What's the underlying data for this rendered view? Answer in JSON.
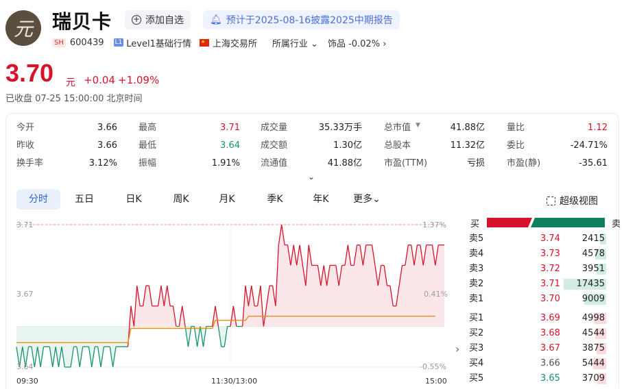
{
  "stock": {
    "name": "瑞贝卡",
    "logo_char": "元",
    "market": "SH",
    "code": "600439",
    "level": "L1",
    "level_text": "Level1基础行情",
    "exchange": "上海交易所",
    "industry_label": "所属行业",
    "sector": "饰品 -0.02%",
    "watch_label": "添加自选",
    "notice": "预计于2025-08-16披露2025中期报告"
  },
  "quote": {
    "price": "3.70",
    "unit": "元",
    "change": "+0.04",
    "change_pct": "+1.09%",
    "status": "已收盘  07-25 15:00:00 北京时间"
  },
  "stats": [
    [
      {
        "label": "今开",
        "value": "3.66"
      },
      {
        "label": "最高",
        "value": "3.71",
        "color": "red"
      },
      {
        "label": "成交量",
        "value": "35.33万手"
      },
      {
        "label": "总市值",
        "value": "41.88亿",
        "dropdown": true
      },
      {
        "label": "量比",
        "value": "1.12",
        "color": "red"
      }
    ],
    [
      {
        "label": "昨收",
        "value": "3.66"
      },
      {
        "label": "最低",
        "value": "3.64",
        "color": "green"
      },
      {
        "label": "成交额",
        "value": "1.30亿"
      },
      {
        "label": "总股本",
        "value": "11.32亿"
      },
      {
        "label": "委比",
        "value": "-24.71%"
      }
    ],
    [
      {
        "label": "换手率",
        "value": "3.12%"
      },
      {
        "label": "振幅",
        "value": "1.91%"
      },
      {
        "label": "流通值",
        "value": "41.88亿"
      },
      {
        "label": "市盈(TTM)",
        "value": "亏损"
      },
      {
        "label": "市盈(静)",
        "value": "-35.61"
      }
    ]
  ],
  "tabs": [
    "分时",
    "五日",
    "日K",
    "周K",
    "月K",
    "季K",
    "年K",
    "更多"
  ],
  "super_view": "超级视图",
  "chart_axis": {
    "y_left": [
      "3.71",
      "3.67",
      "3.64"
    ],
    "y_right": [
      "1.37%",
      "0.41%",
      "-0.55%"
    ],
    "x": [
      "09:30",
      "11:30/13:00",
      "15:00"
    ]
  },
  "chart_data": {
    "type": "line",
    "ylim": [
      3.64,
      3.71
    ],
    "prev_close": 3.66,
    "series": [
      {
        "values": [
          3.65,
          3.64,
          3.65,
          3.64,
          3.65,
          3.65,
          3.64,
          3.65,
          3.64,
          3.65,
          3.65,
          3.65,
          3.64,
          3.65,
          3.64,
          3.65,
          3.64,
          3.64,
          3.64,
          3.65,
          3.65,
          3.64,
          3.65,
          3.65,
          3.65,
          3.64,
          3.65,
          3.65,
          3.64,
          3.65,
          3.65,
          3.65,
          3.64,
          3.65,
          3.65,
          3.65,
          3.65,
          3.65,
          3.67,
          3.66,
          3.68,
          3.67,
          3.67,
          3.68,
          3.68,
          3.67,
          3.67,
          3.67,
          3.68,
          3.67,
          3.68,
          3.67,
          3.67,
          3.66,
          3.66,
          3.67,
          3.66,
          3.65,
          3.66,
          3.66,
          3.65,
          3.66,
          3.65,
          3.66,
          3.66,
          3.66,
          3.67,
          3.66,
          3.65,
          3.65,
          3.66,
          3.66,
          3.67,
          3.66,
          3.66,
          3.66,
          3.68,
          3.67,
          3.68,
          3.67,
          3.67,
          3.68,
          3.66,
          3.67,
          3.68,
          3.68,
          3.67,
          3.7,
          3.71,
          3.7,
          3.7,
          3.69,
          3.7,
          3.69,
          3.7,
          3.69,
          3.68,
          3.7,
          3.69,
          3.69,
          3.69,
          3.68,
          3.69,
          3.68,
          3.69,
          3.69,
          3.69,
          3.68,
          3.69,
          3.69,
          3.7,
          3.69,
          3.69,
          3.7,
          3.7,
          3.69,
          3.7,
          3.7,
          3.7,
          3.69,
          3.68,
          3.69,
          3.69,
          3.68,
          3.68,
          3.67,
          3.67,
          3.68,
          3.69,
          3.69,
          3.7,
          3.7,
          3.69,
          3.7,
          3.7,
          3.69,
          3.7,
          3.7,
          3.7,
          3.69,
          3.7,
          3.7,
          3.7
        ]
      },
      {
        "values": [
          3.652,
          3.652,
          3.652,
          3.652,
          3.652,
          3.652,
          3.652,
          3.652,
          3.652,
          3.652,
          3.652,
          3.652,
          3.652,
          3.652,
          3.652,
          3.652,
          3.652,
          3.652,
          3.652,
          3.652,
          3.652,
          3.652,
          3.652,
          3.652,
          3.652,
          3.652,
          3.652,
          3.652,
          3.652,
          3.652,
          3.652,
          3.652,
          3.652,
          3.652,
          3.652,
          3.652,
          3.652,
          3.652,
          3.659,
          3.659,
          3.659,
          3.659,
          3.659,
          3.659,
          3.659,
          3.659,
          3.659,
          3.659,
          3.659,
          3.659,
          3.659,
          3.659,
          3.659,
          3.659,
          3.659,
          3.659,
          3.659,
          3.659,
          3.659,
          3.659,
          3.659,
          3.659,
          3.659,
          3.659,
          3.659,
          3.659,
          3.663,
          3.663,
          3.663,
          3.663,
          3.663,
          3.663,
          3.663,
          3.663,
          3.663,
          3.663,
          3.663,
          3.665,
          3.665,
          3.665,
          3.665,
          3.665,
          3.665,
          3.665,
          3.665,
          3.665,
          3.665,
          3.665,
          3.665,
          3.665,
          3.665,
          3.665,
          3.665,
          3.665,
          3.665,
          3.665,
          3.665,
          3.665,
          3.665,
          3.665,
          3.665,
          3.665,
          3.665,
          3.665,
          3.665,
          3.665,
          3.665,
          3.665,
          3.665,
          3.665,
          3.665,
          3.665,
          3.665,
          3.665,
          3.665,
          3.665,
          3.665,
          3.665,
          3.665,
          3.665,
          3.665,
          3.665,
          3.665,
          3.665,
          3.665,
          3.665,
          3.665,
          3.665,
          3.665,
          3.665,
          3.665,
          3.665,
          3.665,
          3.665,
          3.665,
          3.665,
          3.665,
          3.665,
          3.665,
          3.665
        ]
      }
    ],
    "colors": {
      "up": "#d8122a",
      "down": "#14936f",
      "avg": "#f08a0c"
    }
  },
  "orderbook": {
    "buy_label": "买",
    "sell_label": "卖",
    "asks": [
      {
        "label": "卖5",
        "price": "3.74",
        "vol": "2415",
        "fill": 0.14
      },
      {
        "label": "卖4",
        "price": "3.73",
        "vol": "4578",
        "fill": 0.26
      },
      {
        "label": "卖3",
        "price": "3.72",
        "vol": "3951",
        "fill": 0.23
      },
      {
        "label": "卖2",
        "price": "3.71",
        "vol": "17435",
        "fill": 1.0
      },
      {
        "label": "卖1",
        "price": "3.70",
        "vol": "9009",
        "fill": 0.52
      }
    ],
    "bids": [
      {
        "label": "买1",
        "price": "3.69",
        "vol": "4998",
        "fill": 0.29
      },
      {
        "label": "买2",
        "price": "3.68",
        "vol": "4544",
        "fill": 0.26
      },
      {
        "label": "买3",
        "price": "3.67",
        "vol": "3875",
        "fill": 0.22
      },
      {
        "label": "买4",
        "price": "3.66",
        "vol": "5444",
        "fill": 0.31
      },
      {
        "label": "买5",
        "price": "3.65",
        "vol": "3709",
        "fill": 0.21
      }
    ]
  }
}
